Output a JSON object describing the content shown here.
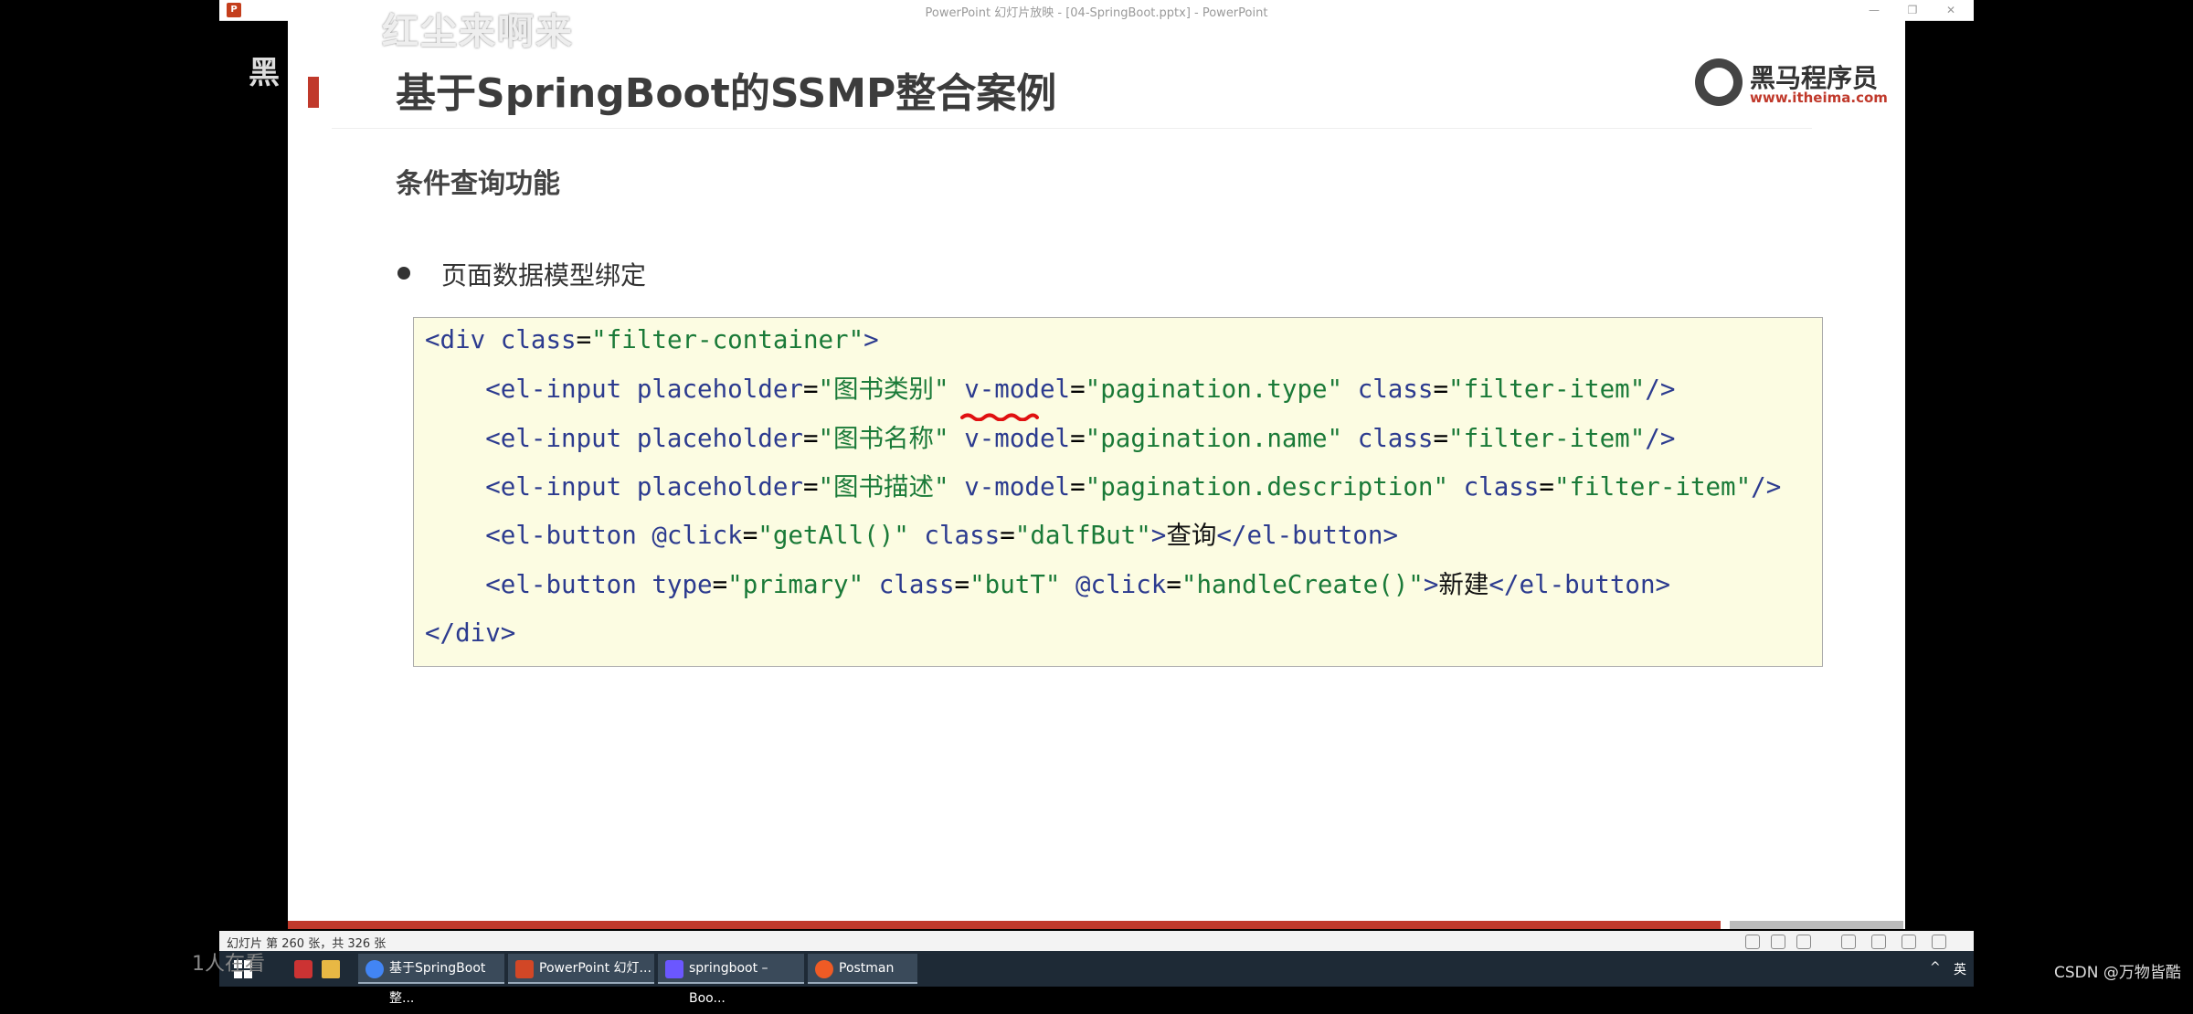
{
  "window": {
    "title": "PowerPoint 幻灯片放映 - [04-SpringBoot.pptx] - PowerPoint",
    "app_icon": "P",
    "controls": [
      "—",
      "❐",
      "✕"
    ]
  },
  "overlay": {
    "stream_title": "红尘来啊来",
    "logo_fragment": "黑"
  },
  "slide": {
    "title": "基于SpringBoot的SSMP整合案例",
    "logo_brand": "黑马程序员",
    "logo_url": "www.itheima.com",
    "subtitle": "条件查询功能",
    "bullet": "页面数据模型绑定",
    "code": {
      "line1": {
        "open": "<div ",
        "attr": "class",
        "eq": "=",
        "val": "\"filter-container\"",
        "close": ">"
      },
      "line2": {
        "tag": "<el-input ",
        "a1": "placeholder",
        "v1": "\"图书类别\"",
        "a2": "v-model",
        "v2": "\"pagination.type\"",
        "a3": "class",
        "v3": "\"filter-item\"",
        "end": "/>"
      },
      "line3": {
        "tag": "<el-input ",
        "a1": "placeholder",
        "v1": "\"图书名称\"",
        "a2": "v-model",
        "v2": "\"pagination.name\"",
        "a3": "class",
        "v3": "\"filter-item\"",
        "end": "/>"
      },
      "line4": {
        "tag": "<el-input ",
        "a1": "placeholder",
        "v1": "\"图书描述\"",
        "a2": "v-model",
        "v2": "\"pagination.description\"",
        "a3": "class",
        "v3": "\"filter-item\"",
        "end": "/>"
      },
      "line5": {
        "tag": "<el-button ",
        "a1": "@click",
        "v1": "\"getAll()\"",
        "a2": "class",
        "v2": "\"dalfBut\"",
        "gt": ">",
        "text": "查询",
        "close": "</el-button>"
      },
      "line6": {
        "tag": "<el-button ",
        "a1": "type",
        "v1": "\"primary\"",
        "a2": "class",
        "v2": "\"butT\"",
        "a3": "@click",
        "v3": "\"handleCreate()\"",
        "gt": ">",
        "text": "新建",
        "close": "</el-button>"
      },
      "line7": {
        "close": "</div>"
      }
    }
  },
  "statusbar": {
    "slide_count": "幻灯片 第 260 张，共 326 张"
  },
  "taskbar": {
    "items": [
      {
        "label": "基于SpringBoot整...",
        "icon": "chrome-icon"
      },
      {
        "label": "PowerPoint 幻灯...",
        "icon": "powerpoint-icon"
      },
      {
        "label": "springboot – Boo...",
        "icon": "intellij-icon"
      },
      {
        "label": "Postman",
        "icon": "postman-icon"
      }
    ],
    "tray_chevron": "^",
    "ime": "英",
    "ghost_text": "1人在看"
  },
  "watermark": "CSDN @万物皆酷",
  "colors": {
    "accent": "#c0392b",
    "code_bg": "#fcfce2",
    "code_tag": "#2c3b8f",
    "code_string": "#1a7a38"
  }
}
